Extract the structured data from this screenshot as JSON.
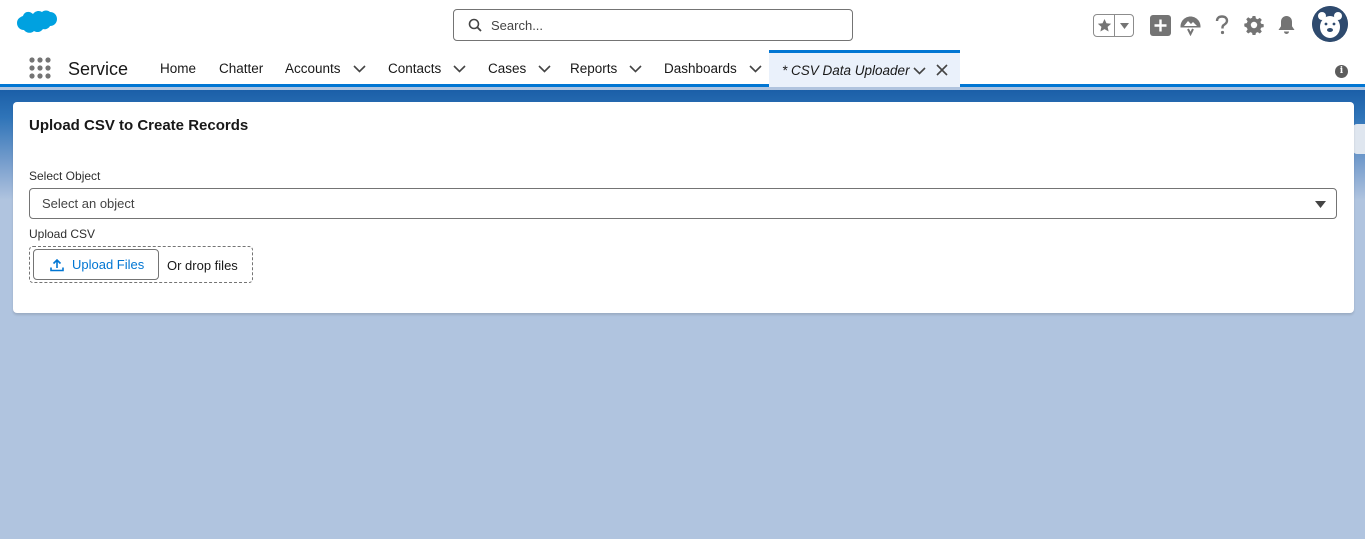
{
  "header": {
    "search_placeholder": "Search...",
    "icons": [
      "salesforce-cloud-logo",
      "favorites-star-icon",
      "favorites-menu-icon",
      "global-actions-add-icon",
      "trailhead-guidance-icon",
      "help-question-icon",
      "setup-gear-icon",
      "notifications-bell-icon",
      "user-avatar"
    ]
  },
  "nav": {
    "app_name": "Service",
    "items": [
      {
        "label": "Home",
        "has_menu": false
      },
      {
        "label": "Chatter",
        "has_menu": false
      },
      {
        "label": "Accounts",
        "has_menu": true
      },
      {
        "label": "Contacts",
        "has_menu": true
      },
      {
        "label": "Cases",
        "has_menu": true
      },
      {
        "label": "Reports",
        "has_menu": true
      },
      {
        "label": "Dashboards",
        "has_menu": true
      }
    ],
    "active_tab": "* CSV Data Uploader"
  },
  "card": {
    "title": "Upload CSV to Create Records",
    "select_label": "Select Object",
    "select_placeholder": "Select an object",
    "upload_label": "Upload CSV",
    "upload_button": "Upload Files",
    "drop_text": "Or drop files"
  },
  "colors": {
    "brand_blue": "#0176d3",
    "background": "#b0c4df",
    "banner_blue": "#1b5fa8",
    "logo_blue": "#00a1e0"
  }
}
